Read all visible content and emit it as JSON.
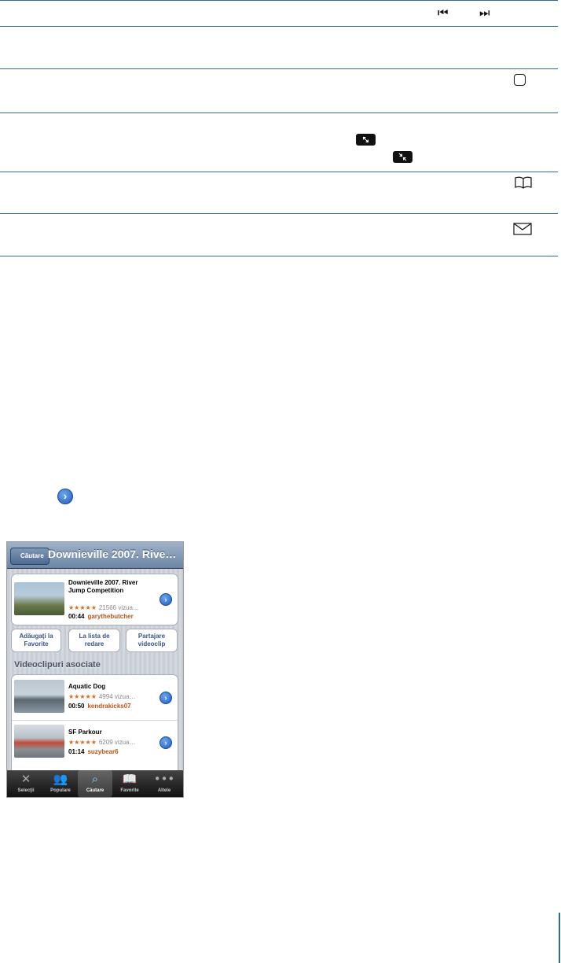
{
  "table": {
    "skip_controls": {
      "prev_icon": "⏮",
      "next_icon": "⏭"
    },
    "icons": [
      "home-button-icon",
      "scale-to-fill-icon",
      "scale-to-fit-icon",
      "bookmark-icon",
      "mail-icon"
    ]
  },
  "detail_button_glyph": "›",
  "phone": {
    "nav": {
      "back_label": "Căutare",
      "title": "Downieville 2007. Rive…"
    },
    "video": {
      "title": "Downieville 2007. River Jump Competition",
      "stars": "★★★★★",
      "views": "21566 vizua…",
      "duration": "00:44",
      "user": "garythebutcher"
    },
    "actions": [
      {
        "label": "Adăugaţi la Favorite"
      },
      {
        "label": "La lista de redare"
      },
      {
        "label": "Partajare videoclip"
      }
    ],
    "section_header": "Videoclipuri asociate",
    "related": [
      {
        "title": "Aquatic Dog",
        "stars": "★★★★★",
        "views": "4994 vizua…",
        "duration": "00:50",
        "user": "kendrakicks07"
      },
      {
        "title": "SF Parkour",
        "stars": "★★★★★",
        "views": "6209 vizua…",
        "duration": "01:14",
        "user": "suzybear6"
      }
    ],
    "tabs": [
      {
        "label": "Selecţii",
        "icon": "✕",
        "selected": false
      },
      {
        "label": "Populare",
        "icon": "👥",
        "selected": false
      },
      {
        "label": "Căutare",
        "icon": "⌕",
        "selected": true
      },
      {
        "label": "Favorite",
        "icon": "📖",
        "selected": false
      },
      {
        "label": "Altele",
        "icon": "•••",
        "selected": false
      }
    ]
  }
}
